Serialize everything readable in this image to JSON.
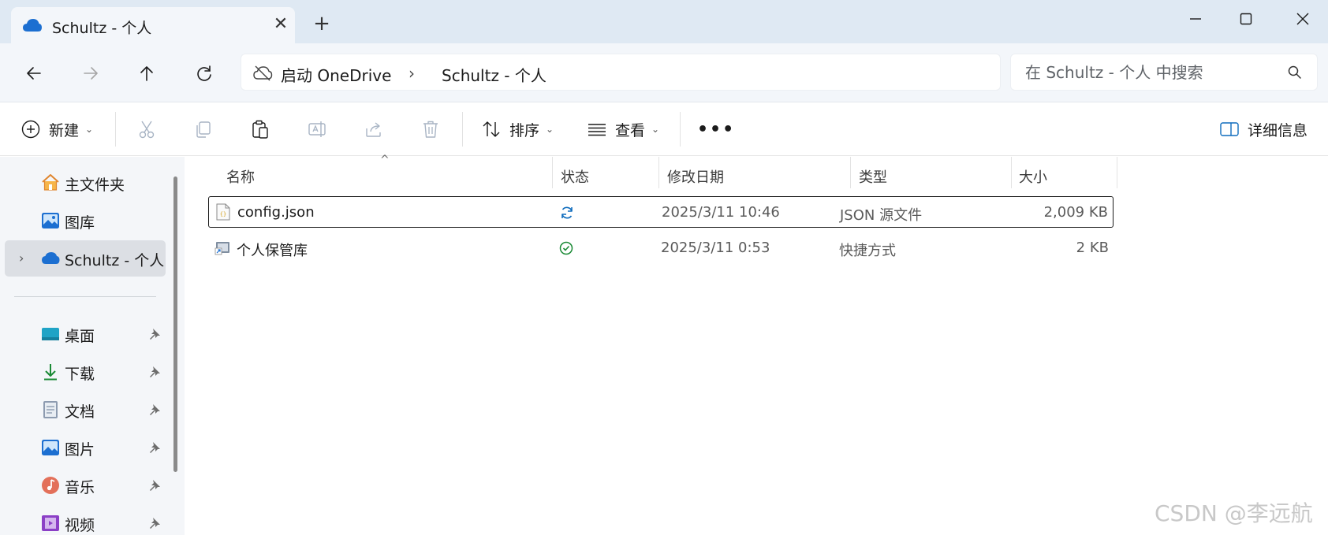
{
  "window": {
    "tab_title": "Schultz - 个人",
    "tab_close": "✕",
    "new_tab": "+"
  },
  "address": {
    "crumb1": "启动 OneDrive",
    "separator": "›",
    "crumb2": "Schultz - 个人"
  },
  "search": {
    "placeholder": "在 Schultz - 个人 中搜索"
  },
  "commands": {
    "new_label": "新建",
    "sort_label": "排序",
    "view_label": "查看",
    "details_label": "详细信息",
    "more": "•••"
  },
  "sidebar": {
    "items": [
      {
        "label": "主文件夹",
        "icon": "home-icon"
      },
      {
        "label": "图库",
        "icon": "gallery-icon"
      },
      {
        "label": "Schultz - 个人",
        "icon": "onedrive-icon",
        "selected": true,
        "expander": "›"
      }
    ],
    "pinned": [
      {
        "label": "桌面",
        "icon": "desktop-icon"
      },
      {
        "label": "下载",
        "icon": "download-icon"
      },
      {
        "label": "文档",
        "icon": "documents-icon"
      },
      {
        "label": "图片",
        "icon": "pictures-icon"
      },
      {
        "label": "音乐",
        "icon": "music-icon"
      },
      {
        "label": "视频",
        "icon": "videos-icon"
      }
    ]
  },
  "table": {
    "columns": [
      "名称",
      "状态",
      "修改日期",
      "类型",
      "大小"
    ],
    "sort_indicator": "^",
    "rows": [
      {
        "name": "config.json",
        "status": "syncing",
        "modified": "2025/3/11 10:46",
        "type": "JSON 源文件",
        "size": "2,009 KB",
        "icon": "json-file-icon"
      },
      {
        "name": "个人保管库",
        "status": "synced",
        "modified": "2025/3/11 0:53",
        "type": "快捷方式",
        "size": "2 KB",
        "icon": "shortcut-icon"
      }
    ]
  },
  "watermark": "CSDN @李远航",
  "colors": {
    "onedrive_blue": "#1c6fd1",
    "sync_blue": "#0f6cbd",
    "synced_green": "#1a8a35",
    "titlebar": "#dfe9f3"
  }
}
